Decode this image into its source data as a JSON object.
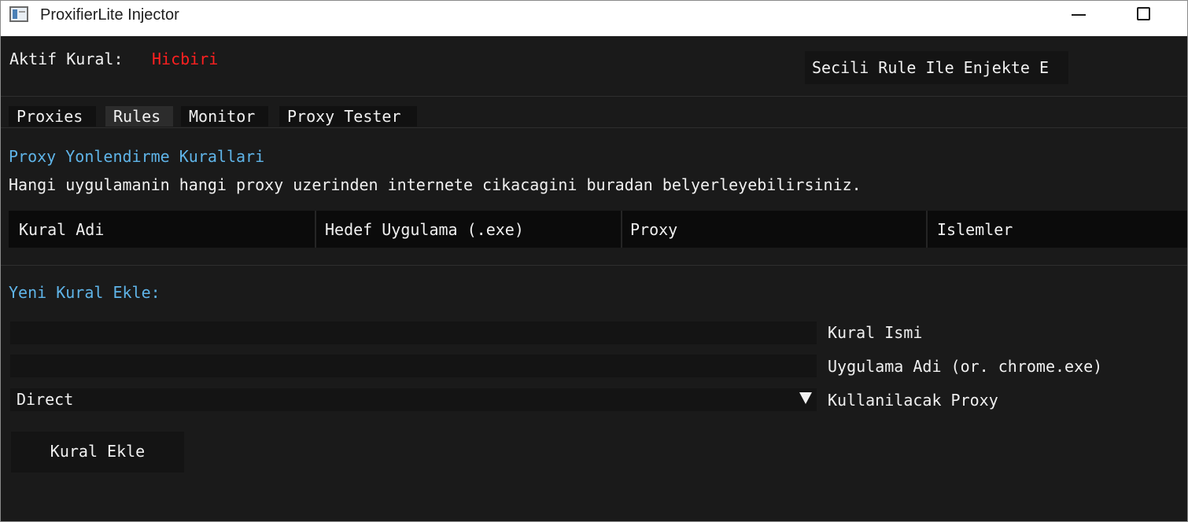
{
  "window": {
    "title": "ProxifierLite Injector"
  },
  "header": {
    "active_rule_label": "Aktif Kural:",
    "active_rule_value": "Hicbiri",
    "inject_button_label": "Secili Rule Ile Enjekte E"
  },
  "tabs": [
    {
      "label": "Proxies",
      "active": false
    },
    {
      "label": "Rules",
      "active": true
    },
    {
      "label": "Monitor",
      "active": false
    },
    {
      "label": "Proxy Tester",
      "active": false
    }
  ],
  "rules": {
    "title": "Proxy Yonlendirme Kurallari",
    "description": "Hangi uygulamanin hangi proxy uzerinden internete cikacagini buradan belyerleyebilirsiniz.",
    "columns": [
      "Kural Adi",
      "Hedef Uygulama (.exe)",
      "Proxy",
      "Islemler"
    ],
    "rows": []
  },
  "new_rule": {
    "title": "Yeni Kural Ekle:",
    "name_label": "Kural Ismi",
    "name_value": "",
    "app_label": "Uygulama Adi (or. chrome.exe)",
    "app_value": "",
    "proxy_label": "Kullanilacak Proxy",
    "proxy_selected": "Direct",
    "add_button_label": "Kural Ekle"
  },
  "colors": {
    "background": "#1a1a1a",
    "accent_text": "#5fb4e8",
    "warning_text": "#ff2020",
    "text": "#f0f0f0"
  }
}
